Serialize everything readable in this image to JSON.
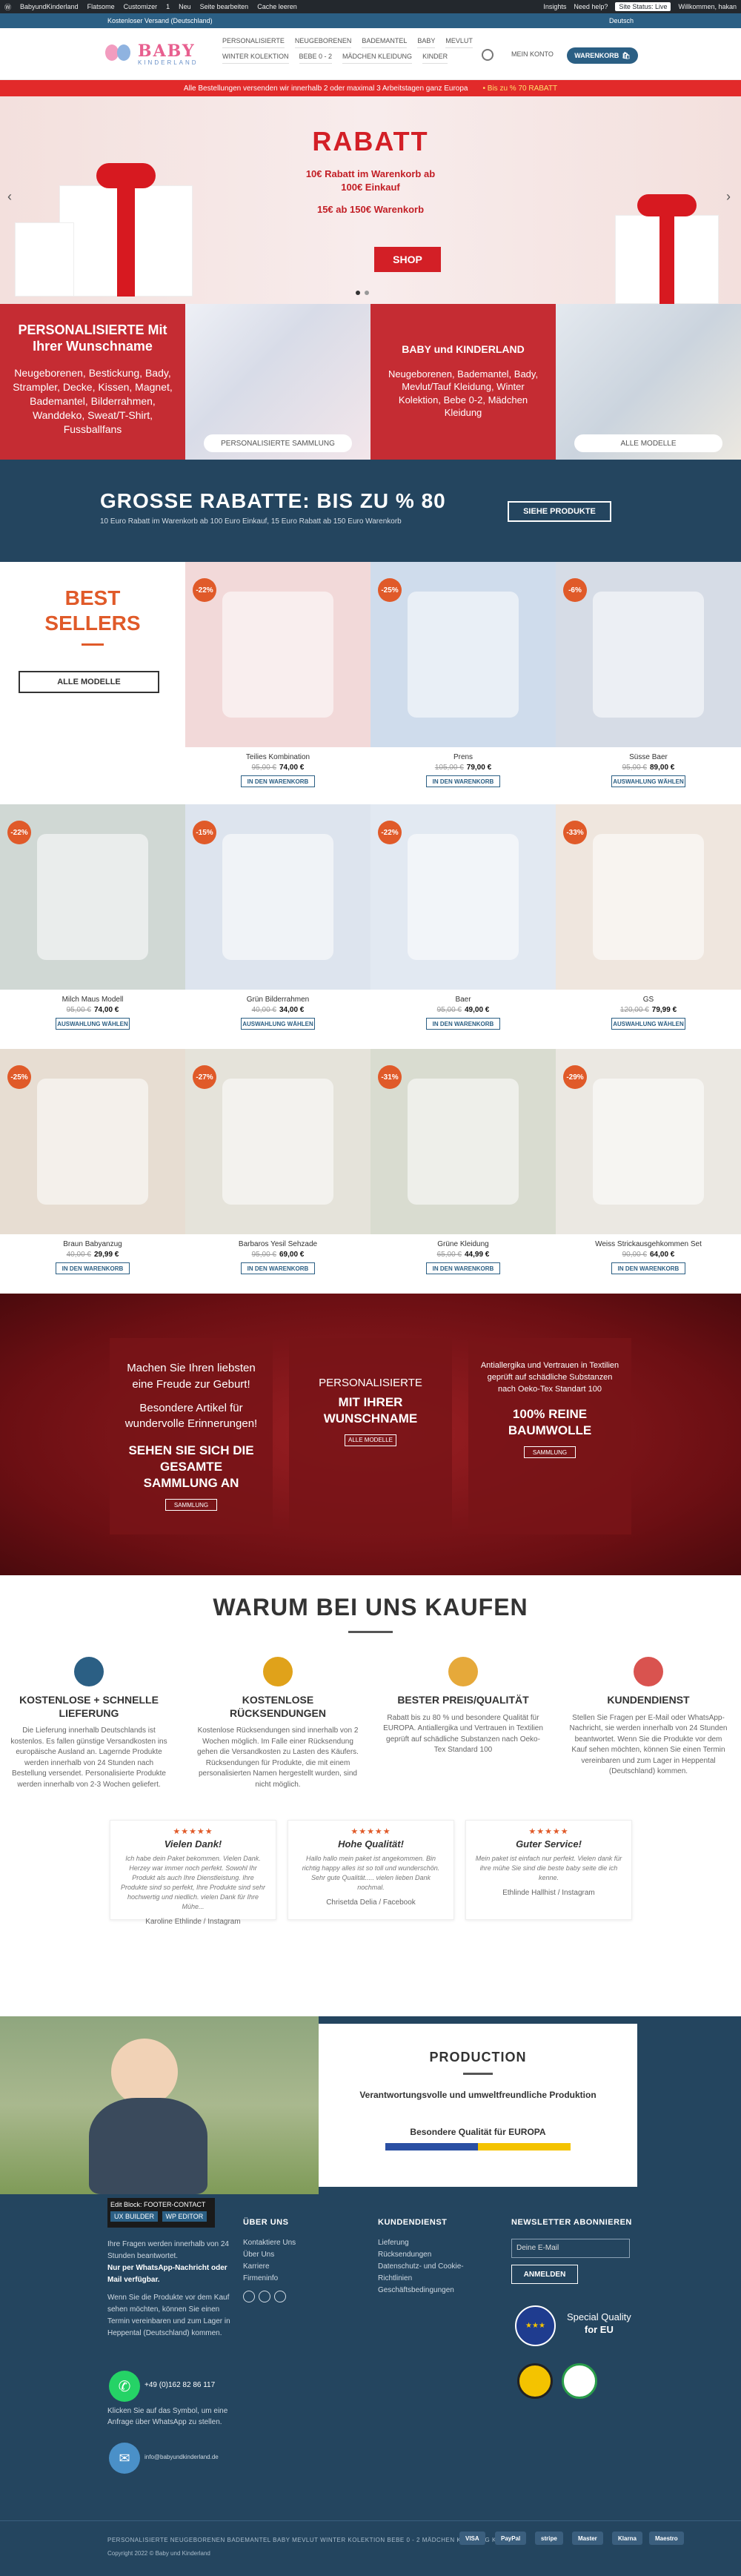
{
  "admin_bar": {
    "items": [
      "BabyundKinderland",
      "Flatsome",
      "Customizer",
      "1",
      "Neu",
      "Seite bearbeiten",
      "Cache leeren",
      "Insights",
      "Need help?"
    ],
    "site_status": "Site Status: Live",
    "greeting": "Willkommen, hakan"
  },
  "topbar": {
    "left": "Kostenloser Versand (Deutschland)",
    "lang": "Deutsch"
  },
  "logo": {
    "main": "BABY",
    "sub": "KINDERLAND"
  },
  "nav": {
    "items": [
      "PERSONALISIERTE",
      "NEUGEBORENEN",
      "BADEMANTEL",
      "BABY",
      "MEVLUT",
      "WINTER KOLEKTION",
      "BEBE 0 - 2",
      "MÄDCHEN KLEIDUNG",
      "KINDER"
    ],
    "account": "MEIN KONTO",
    "cart": "WARENKORB"
  },
  "promo": {
    "left": "Alle Bestellungen versenden wir innerhalb 2 oder maximal 3 Arbeitstagen ganz Europa",
    "right": "• Bis zu % 70 RABATT"
  },
  "hero": {
    "title": "RABATT",
    "line1": "10€ Rabatt im Warenkorb ab",
    "line2": "100€ Einkauf",
    "line3": "15€ ab 150€ Warenkorb",
    "button": "SHOP"
  },
  "collections": {
    "personal_title": "PERSONALISIERTE Mit Ihrer Wunschname",
    "personal_text": "Neugeborenen, Bestickung, Bady, Strampler, Decke, Kissen, Magnet, Bademantel, Bilderrahmen, Wanddeko, Sweat/T-Shirt, Fussballfans",
    "personal_btn": "PERSONALISIERTE SAMMLUNG",
    "baby_title": "BABY und KINDERLAND",
    "baby_text": "Neugeborenen, Bademantel, Bady, Mevlut/Tauf Kleidung, Winter Kolektion, Bebe 0-2, Mädchen Kleidung",
    "baby_btn": "ALLE MODELLE"
  },
  "banner": {
    "title": "GROSSE RABATTE: BIS ZU % 80",
    "sub": "10 Euro Rabatt im Warenkorb ab 100 Euro Einkauf, 15 Euro Rabatt ab 150 Euro Warenkorb",
    "button": "SIEHE PRODUKTE"
  },
  "best": {
    "title1": "BEST",
    "title2": "SELLERS",
    "button": "ALLE MODELLE"
  },
  "products": [
    {
      "discount": "-22%",
      "name": "Teilies Kombination",
      "old": "95,00 €",
      "price": "74,00 €",
      "btn": "IN DEN WARENKORB",
      "bg": "#f2d9d9"
    },
    {
      "discount": "-25%",
      "name": "Prens",
      "old": "105,00 €",
      "price": "79,00 €",
      "btn": "IN DEN WARENKORB",
      "bg": "#cfdcec"
    },
    {
      "discount": "-6%",
      "name": "Süsse Baer",
      "old": "95,00 €",
      "price": "89,00 €",
      "btn": "AUSWAHLUNG WÄHLEN",
      "bg": "#d6dce6"
    },
    {
      "discount": "-22%",
      "name": "Milch Maus Modell",
      "old": "95,00 €",
      "price": "74,00 €",
      "btn": "AUSWAHLUNG WÄHLEN",
      "bg": "#d0d8d4"
    },
    {
      "discount": "-15%",
      "name": "Grün Bilderrahmen",
      "old": "40,00 €",
      "price": "34,00 €",
      "btn": "AUSWAHLUNG WÄHLEN",
      "bg": "#dde4ee"
    },
    {
      "discount": "-22%",
      "name": "Baer",
      "old": "95,00 €",
      "price": "49,00 €",
      "btn": "IN DEN WARENKORB",
      "bg": "#e2e9f2"
    },
    {
      "discount": "-33%",
      "name": "GS",
      "old": "120,00 €",
      "price": "79,99 €",
      "btn": "AUSWAHLUNG WÄHLEN",
      "bg": "#efe6de"
    },
    {
      "discount": "-25%",
      "name": "Braun Babyanzug",
      "old": "40,00 €",
      "price": "29,99 €",
      "btn": "IN DEN WARENKORB",
      "bg": "#e7ddd2"
    },
    {
      "discount": "-27%",
      "name": "Barbaros Yesil Sehzade",
      "old": "95,00 €",
      "price": "69,00 €",
      "btn": "IN DEN WARENKORB",
      "bg": "#e5e3da"
    },
    {
      "discount": "-31%",
      "name": "Grüne Kleidung",
      "old": "65,00 €",
      "price": "44,99 €",
      "btn": "IN DEN WARENKORB",
      "bg": "#d9dcd0"
    },
    {
      "discount": "-29%",
      "name": "Weiss Strickausgehkommen Set",
      "old": "90,00 €",
      "price": "64,00 €",
      "btn": "IN DEN WARENKORB",
      "bg": "#ebe8e2"
    }
  ],
  "xmas": {
    "card1": {
      "l1": "Machen Sie Ihren liebsten eine Freude zur Geburt!",
      "l2": "Besondere Artikel für wundervolle Erinnerungen!",
      "l3": "SEHEN SIE SICH DIE GESAMTE SAMMLUNG AN",
      "btn": "SAMMLUNG"
    },
    "card2": {
      "l1": "PERSONALISIERTE",
      "l3": "MIT IHRER WUNSCHNAME",
      "btn": "ALLE MODELLE"
    },
    "card3": {
      "l1": "Antiallergika und Vertrauen in Textilien geprüft auf schädliche Substanzen nach Oeko-Tex Standart 100",
      "l3": "100% REINE BAUMWOLLE",
      "btn": "SAMMLUNG"
    }
  },
  "why": {
    "title": "WARUM BEI UNS KAUFEN",
    "features": [
      {
        "title": "KOSTENLOSE + SCHNELLE LIEFERUNG",
        "text": "Die Lieferung innerhalb Deutschlands ist kostenlos. Es fallen günstige Versandkosten ins europäische Ausland an. Lagernde Produkte werden innerhalb von 24 Stunden nach Bestellung versendet. Personalisierte Produkte werden innerhalb von 2-3 Wochen geliefert.",
        "color": "#2b5f84"
      },
      {
        "title": "KOSTENLOSE RÜCKSENDUNGEN",
        "text": "Kostenlose Rücksendungen sind innerhalb von 2 Wochen möglich. Im Falle einer Rücksendung gehen die Versandkosten zu Lasten des Käufers. Rücksendungen für Produkte, die mit einem personalisierten Namen hergestellt wurden, sind nicht möglich.",
        "color": "#e0a21a"
      },
      {
        "title": "BESTER PREIS/QUALITÄT",
        "text": "Rabatt bis zu 80 % und besondere Qualität für EUROPA. Antiallergika und Vertrauen in Textilien geprüft auf schädliche Substanzen nach Oeko-Tex Standard 100",
        "color": "#e6a93a"
      },
      {
        "title": "KUNDENDIENST",
        "text": "Stellen Sie Fragen per E-Mail oder WhatsApp-Nachricht, sie werden innerhalb von 24 Stunden beantwortet. Wenn Sie die Produkte vor dem Kauf sehen möchten, können Sie einen Termin vereinbaren und zum Lager in Heppental (Deutschland) kommen.",
        "color": "#d9534f"
      }
    ]
  },
  "reviews": [
    {
      "stars": "★★★★★",
      "title": "Vielen Dank!",
      "text": "Ich habe dein Paket bekommen. Vielen Dank. Herzey war immer noch perfekt. Sowohl Ihr Produkt als auch Ihre Dienstleistung. Ihre Produkte sind so perfekt, Ihre Produkte sind sehr hochwertig und niedlich. vielen Dank für Ihre Mühe...",
      "author": "Karoline Ethlinde / Instagram"
    },
    {
      "stars": "★★★★★",
      "title": "Hohe Qualität!",
      "text": "Hallo hallo mein paket ist angekommen. Bin richtig happy alles ist so toll und wunderschön. Sehr gute Qualität..... vielen lieben Dank nochmal.",
      "author": "Chrisetda Delia / Facebook"
    },
    {
      "stars": "★★★★★",
      "title": "Guter Service!",
      "text": "Mein paket ist einfach nur perfekt. Vielen dank für ihre mühe Sie sind die beste baby seite die ich kenne.",
      "author": "Ethlinde Hallhist / Instagram"
    }
  ],
  "production": {
    "title": "PRODUCTION",
    "line1": "Verantwortungsvolle und umweltfreundliche Produktion",
    "line2": "Besondere Qualität für EUROPA"
  },
  "footer": {
    "edit_title": "Edit Block: FOOTER-CONTACT",
    "edit_btn1": "UX BUILDER",
    "edit_btn2": "WP EDITOR",
    "contact1": "Ihre Fragen werden innerhalb von 24 Stunden beantwortet.",
    "contact2": "Nur per WhatsApp-Nachricht oder Mail verfügbar.",
    "contact3": "Wenn Sie die Produkte vor dem Kauf sehen möchten, können Sie einen Termin vereinbaren und zum Lager in Heppental (Deutschland) kommen.",
    "phone": "+49 (0)162 82 86 117",
    "wa_text": "Klicken Sie auf das Symbol, um eine Anfrage über WhatsApp zu stellen.",
    "email": "info@babyundkinderland.de",
    "col2_title": "ÜBER UNS",
    "col2": [
      "Kontaktiere Uns",
      "Über Uns",
      "Karriere",
      "Firmeninfo"
    ],
    "col3_title": "KUNDENDIENST",
    "col3": [
      "Lieferung",
      "Rücksendungen",
      "Datenschutz- und Cookie-Richtlinien",
      "Geschäftsbedingungen"
    ],
    "col4_title": "NEWSLETTER ABONNIEREN",
    "nl_placeholder": "Deine E-Mail",
    "nl_btn": "ANMELDEN",
    "eu1": "Special Quality",
    "eu2": "for EU",
    "menu": "PERSONALISIERTE  NEUGEBORENEN  BADEMANTEL  BABY  MEVLUT  WINTER KOLEKTION  BEBE 0 - 2  MÄDCHEN KLEIDUNG  KINDER",
    "copyright": "Copyright 2022 © Baby und Kinderland",
    "payments": [
      "VISA",
      "PayPal",
      "stripe",
      "Master",
      "Klarna",
      "Maestro"
    ]
  }
}
